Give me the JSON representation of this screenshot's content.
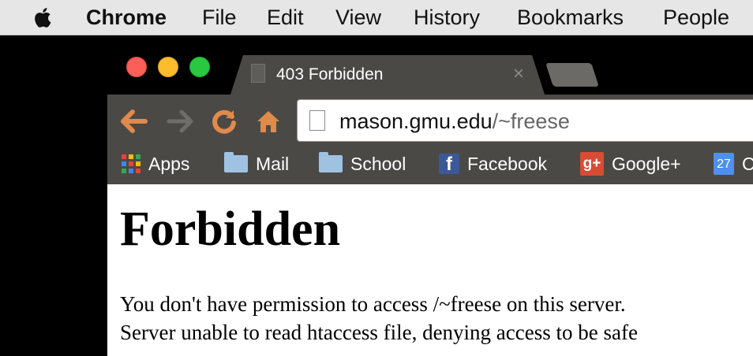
{
  "menubar": {
    "app_name": "Chrome",
    "items": [
      "File",
      "Edit",
      "View",
      "History",
      "Bookmarks",
      "People"
    ]
  },
  "tab": {
    "title": "403 Forbidden",
    "close_glyph": "×"
  },
  "omnibox": {
    "host": "mason.gmu.edu",
    "path": "/~freese"
  },
  "bookmarks": [
    {
      "label": "Apps",
      "icon": "apps-grid-icon"
    },
    {
      "label": "Mail",
      "icon": "folder-icon"
    },
    {
      "label": "School",
      "icon": "folder-icon"
    },
    {
      "label": "Facebook",
      "icon": "facebook-icon"
    },
    {
      "label": "Google+",
      "icon": "google-plus-icon"
    },
    {
      "label": "C",
      "icon": "calendar-icon"
    }
  ],
  "icons": {
    "facebook_glyph": "f",
    "google_plus_glyph": "g+",
    "calendar_day": "27"
  },
  "page": {
    "heading": "Forbidden",
    "line1": "You don't have permission to access /~freese on this server.",
    "line2": "Server unable to read htaccess file, denying access to be safe"
  },
  "colors": {
    "menubar_bg": "#e6e6e6",
    "chrome_dark": "#4b4946",
    "nav_orange": "#e08a4c"
  }
}
